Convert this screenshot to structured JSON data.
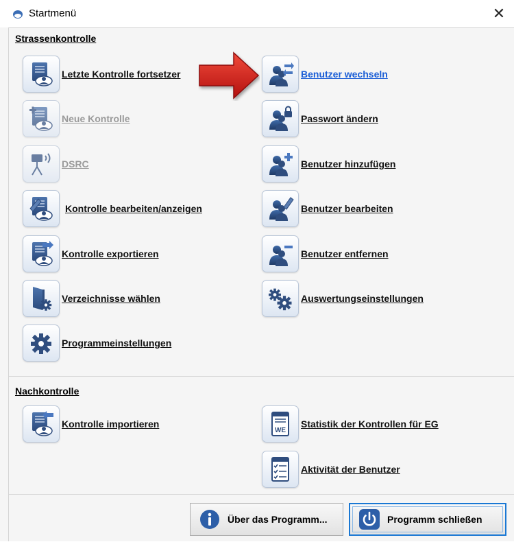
{
  "window": {
    "title": "Startmenü",
    "close_glyph": "✕"
  },
  "sections": {
    "strassenkontrolle": {
      "title": "Strassenkontrolle"
    },
    "nachkontrolle": {
      "title": "Nachkontrolle"
    }
  },
  "items": {
    "letzte_kontrolle": {
      "label": "Letzte Kontrolle fortsetzer",
      "icon": "document-user-icon"
    },
    "neue_kontrolle": {
      "label": "Neue Kontrolle",
      "icon": "new-document-icon",
      "disabled": true
    },
    "dsrc": {
      "label": "DSRC",
      "icon": "signal-antenna-icon",
      "disabled": true
    },
    "kontrolle_bearbeiten": {
      "label": "Kontrolle bearbeiten/anzeigen",
      "icon": "edit-document-icon"
    },
    "kontrolle_exportieren": {
      "label": "Kontrolle exportieren",
      "icon": "export-document-icon"
    },
    "verzeichnisse": {
      "label": "Verzeichnisse wählen",
      "icon": "folder-gear-icon"
    },
    "programmeinstellungen": {
      "label": "Programmeinstellungen",
      "icon": "gear-icon"
    },
    "benutzer_wechseln": {
      "label": "Benutzer wechseln",
      "icon": "switch-user-icon",
      "selected": true
    },
    "passwort_aendern": {
      "label": "Passwort ändern",
      "icon": "lock-user-icon"
    },
    "benutzer_hinzufuegen": {
      "label": "Benutzer hinzufügen",
      "icon": "add-user-icon"
    },
    "benutzer_bearbeiten": {
      "label": "Benutzer bearbeiten",
      "icon": "edit-user-icon"
    },
    "benutzer_entfernen": {
      "label": "Benutzer entfernen",
      "icon": "remove-user-icon"
    },
    "auswertungseinstellungen": {
      "label": "Auswertungseinstellungen",
      "icon": "gears-icon"
    },
    "kontrolle_importieren": {
      "label": "Kontrolle importieren",
      "icon": "import-document-icon"
    },
    "statistik": {
      "label": "Statistik der Kontrollen für EG",
      "icon": "we-report-icon",
      "icon_text": "WE"
    },
    "aktivitaet": {
      "label": "Aktivität der Benutzer",
      "icon": "checklist-icon"
    }
  },
  "buttons": {
    "about": {
      "label": "Über das Programm...",
      "icon": "info-icon"
    },
    "close_program": {
      "label": "Programm schließen",
      "icon": "power-icon"
    }
  },
  "colors": {
    "accent": "#1a78d4",
    "link_selected": "#1b5ed6",
    "icon_blue": "#2f4d7e",
    "arrow_red": "#d11a1a"
  }
}
